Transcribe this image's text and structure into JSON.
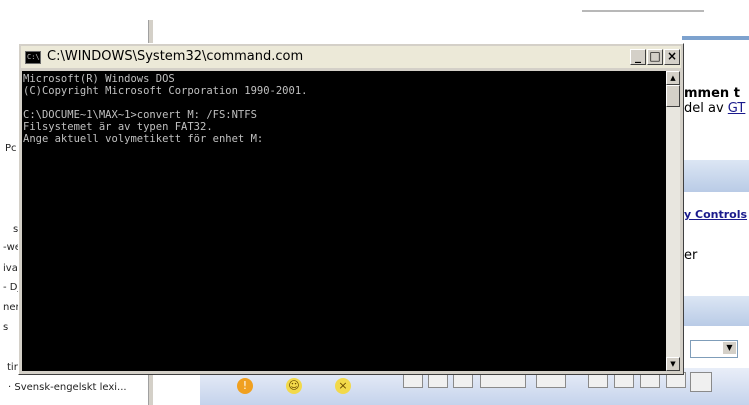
{
  "console": {
    "title": "C:\\WINDOWS\\System32\\command.com",
    "lines": [
      "Microsoft(R) Windows DOS",
      "(C)Copyright Microsoft Corporation 1990-2001.",
      "",
      "C:\\DOCUME~1\\MAX~1>convert M: /FS:NTFS",
      "Filsystemet är av typen FAT32.",
      "Ange aktuell volymetikett för enhet M:"
    ],
    "buttons": {
      "minimize": "_",
      "maximize": "□",
      "close": "×"
    },
    "scroll_up": "▲",
    "scroll_down": "▼"
  },
  "background": {
    "left_fragments": [
      "Pc",
      "s",
      "-we",
      "iva",
      "- Dj",
      "ner",
      "s",
      "tir"
    ],
    "left_bottom_item": "· Svensk-engelskt lexi...",
    "right_fragments": {
      "line1": "mmen t",
      "line2_prefix": "del av ",
      "line2_link": "GT",
      "controls_link": "y Controls",
      "line3": "er"
    },
    "combo_arrow": "▼"
  },
  "colors": {
    "console_bg": "#000000",
    "console_fg": "#c0c0c0",
    "window_face": "#d4d0c8"
  }
}
